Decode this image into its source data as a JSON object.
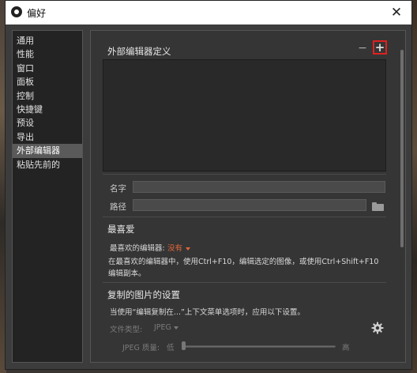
{
  "window": {
    "title": "偏好",
    "close_symbol": "✕"
  },
  "sidebar": {
    "items": [
      {
        "label": "通用"
      },
      {
        "label": "性能"
      },
      {
        "label": "窗口"
      },
      {
        "label": "面板"
      },
      {
        "label": "控制"
      },
      {
        "label": "快捷键"
      },
      {
        "label": "预设"
      },
      {
        "label": "导出"
      },
      {
        "label": "外部编辑器"
      },
      {
        "label": "粘贴先前的"
      }
    ],
    "active": "外部编辑器"
  },
  "external_editor": {
    "title": "外部编辑器定义",
    "remove_symbol": "−",
    "add_symbol": "+",
    "name_label": "名字",
    "path_label": "路径",
    "name_value": "",
    "path_value": ""
  },
  "favorite": {
    "title": "最喜爱",
    "editor_label": "最喜欢的编辑器:",
    "editor_value": "没有",
    "description": "在最喜欢的编辑器中，使用Ctrl+F10，编辑选定的图像，或使用Ctrl+Shift+F10编辑副本。"
  },
  "copy_settings": {
    "title": "复制的图片的设置",
    "note": "当使用“编辑复制在...”上下文菜单选项时，应用以下设置。",
    "file_type_label": "文件类型:",
    "file_type_value": "JPEG",
    "quality_label": "JPEG 质量:",
    "quality_low": "低",
    "quality_high": "高",
    "quality_level": 0.0
  },
  "colors": {
    "accent": "#e0663a",
    "highlight_border": "#e02020",
    "active_item": "#5a5a5a"
  }
}
